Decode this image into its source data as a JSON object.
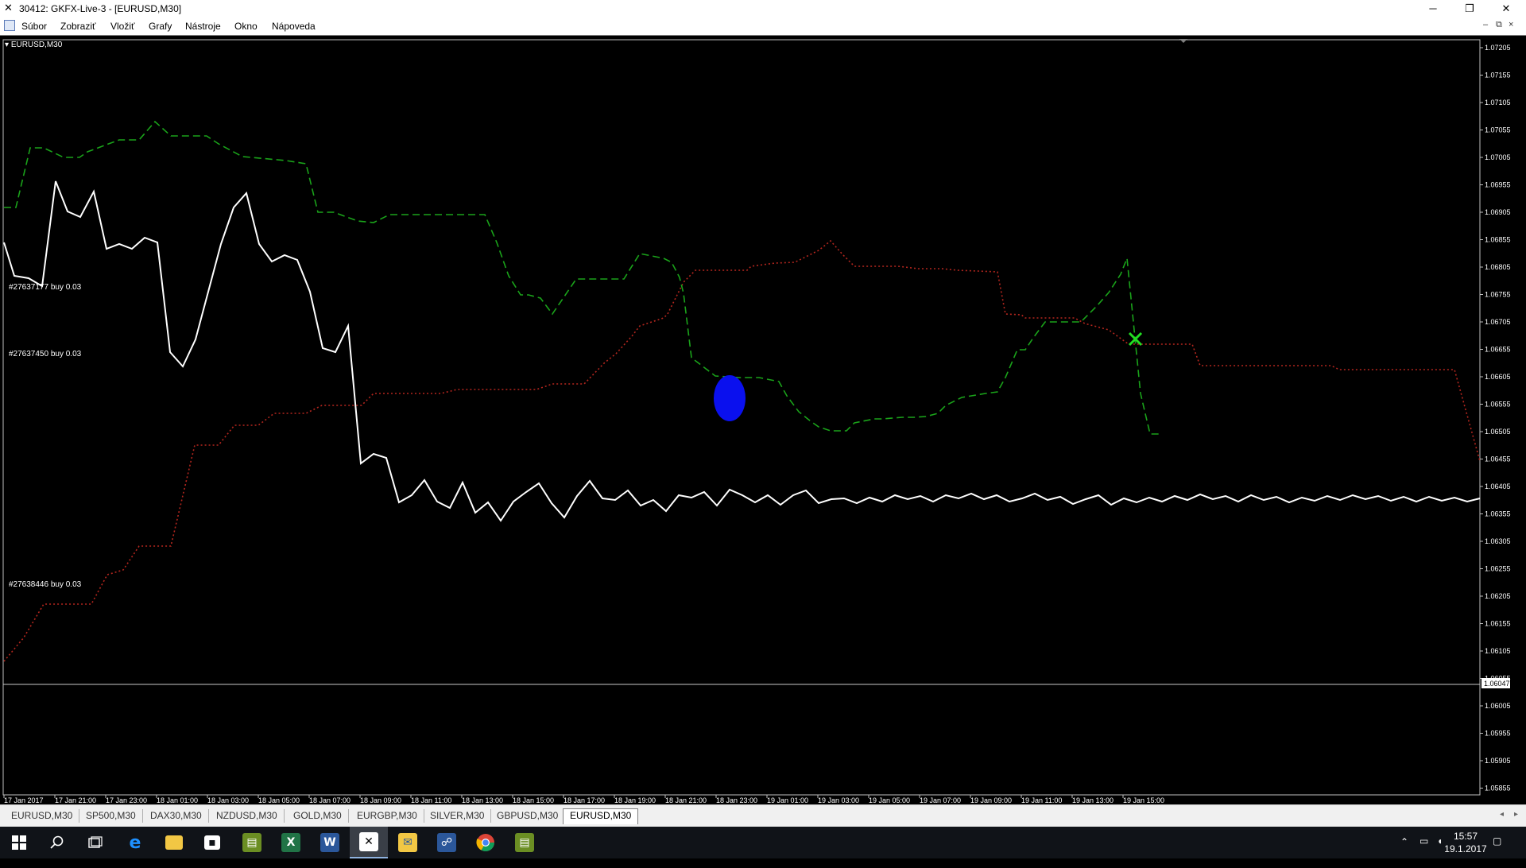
{
  "window": {
    "title": "30412: GKFX-Live-3 - [EURUSD,M30]",
    "controls": {
      "minimize": "─",
      "restore": "❐",
      "close": "✕"
    },
    "mdi_controls": {
      "minimize": "–",
      "restore": "⧉",
      "close": "×"
    }
  },
  "menu": [
    "Súbor",
    "Zobraziť",
    "Vložiť",
    "Grafy",
    "Nástroje",
    "Okno",
    "Nápoveda"
  ],
  "chart": {
    "symbol_label": "EURUSD,M30",
    "current_price": "1.06047",
    "price_axis": [
      "1.07205",
      "1.07155",
      "1.07105",
      "1.07055",
      "1.07005",
      "1.06955",
      "1.06905",
      "1.06855",
      "1.06805",
      "1.06755",
      "1.06705",
      "1.06655",
      "1.06605",
      "1.06555",
      "1.06505",
      "1.06455",
      "1.06405",
      "1.06355",
      "1.06305",
      "1.06255",
      "1.06205",
      "1.06155",
      "1.06105",
      "1.06055",
      "1.06005",
      "1.05955",
      "1.05905",
      "1.05855"
    ],
    "time_axis": [
      "17 Jan 2017",
      "17 Jan 21:00",
      "17 Jan 23:00",
      "18 Jan 01:00",
      "18 Jan 03:00",
      "18 Jan 05:00",
      "18 Jan 07:00",
      "18 Jan 09:00",
      "18 Jan 11:00",
      "18 Jan 13:00",
      "18 Jan 15:00",
      "18 Jan 17:00",
      "18 Jan 19:00",
      "18 Jan 21:00",
      "18 Jan 23:00",
      "19 Jan 01:00",
      "19 Jan 03:00",
      "19 Jan 05:00",
      "19 Jan 07:00",
      "19 Jan 09:00",
      "19 Jan 11:00",
      "19 Jan 13:00",
      "19 Jan 15:00"
    ],
    "orders": [
      "#27637177 buy 0.03",
      "#27637450 buy 0.03",
      "#27638446 buy 0.03"
    ],
    "colors": {
      "price_line": "#ffffff",
      "green_line": "#1aa31a",
      "red_line": "#b3261e",
      "blue_marker": "#0a10ee",
      "x_marker": "#22dd22"
    }
  },
  "tabs": [
    "EURUSD,M30",
    "SP500,M30",
    "DAX30,M30",
    "NZDUSD,M30",
    "GOLD,M30",
    "EURGBP,M30",
    "SILVER,M30",
    "GBPUSD,M30",
    "EURUSD,M30"
  ],
  "active_tab_index": 8,
  "taskbar": {
    "apps": [
      "start-icon",
      "search-icon",
      "task-view-icon",
      "edge-icon",
      "file-explorer-icon",
      "store-icon",
      "mt4-icon",
      "excel-icon",
      "word-icon",
      "xtb-icon",
      "mail-icon",
      "people-icon",
      "chrome-icon",
      "mt4-alt-icon"
    ],
    "clock_time": "15:57",
    "clock_date": "19.1.2017"
  }
}
